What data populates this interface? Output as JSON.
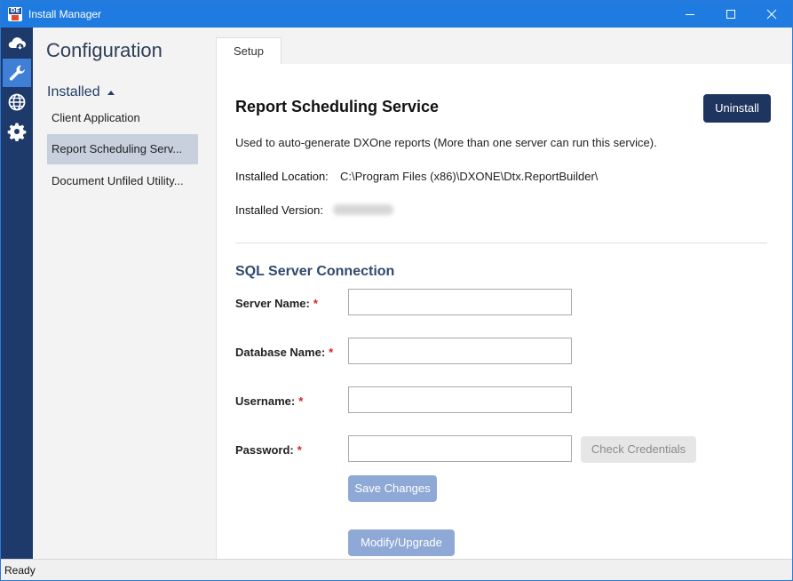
{
  "window": {
    "title": "Install Manager",
    "icon": "dxone-app-icon",
    "controls": [
      "minimize-icon",
      "maximize-icon",
      "close-icon"
    ]
  },
  "rail": {
    "items": [
      {
        "icon": "cloud-download-icon",
        "active": false
      },
      {
        "icon": "wrench-icon",
        "active": true
      },
      {
        "icon": "globe-icon",
        "active": false
      },
      {
        "icon": "gear-icon",
        "active": false
      }
    ]
  },
  "sidebar": {
    "heading": "Configuration",
    "section_label": "Installed",
    "items": [
      {
        "label": "Client Application",
        "active": false
      },
      {
        "label": "Report Scheduling Serv...",
        "active": true
      },
      {
        "label": "Document Unfiled Utility...",
        "active": false
      }
    ]
  },
  "main": {
    "tabs": [
      {
        "label": "Setup"
      }
    ],
    "service": {
      "title": "Report Scheduling Service",
      "uninstall_label": "Uninstall",
      "description": "Used to auto-generate DXOne reports (More than one server can run this service).",
      "location_label": "Installed Location:",
      "location_value": "C:\\Program Files (x86)\\DXONE\\Dtx.ReportBuilder\\",
      "version_label": "Installed Version:"
    },
    "sql": {
      "heading": "SQL Server Connection",
      "required_marker": "*",
      "server_label": "Server Name:",
      "server_value": "",
      "database_label": "Database Name:",
      "database_value": "",
      "username_label": "Username:",
      "username_value": "",
      "password_label": "Password:",
      "password_value": "",
      "check_label": "Check Credentials",
      "save_label": "Save Changes",
      "modify_label": "Modify/Upgrade"
    }
  },
  "status_bar": {
    "text": "Ready"
  },
  "colors": {
    "titlebar": "#1f7be0",
    "rail": "#1d3a6b",
    "rail_active": "#3f80d6",
    "primary_button": "#1e3560",
    "disabled_blue_button": "#8fa9d6",
    "required": "#e02020"
  }
}
